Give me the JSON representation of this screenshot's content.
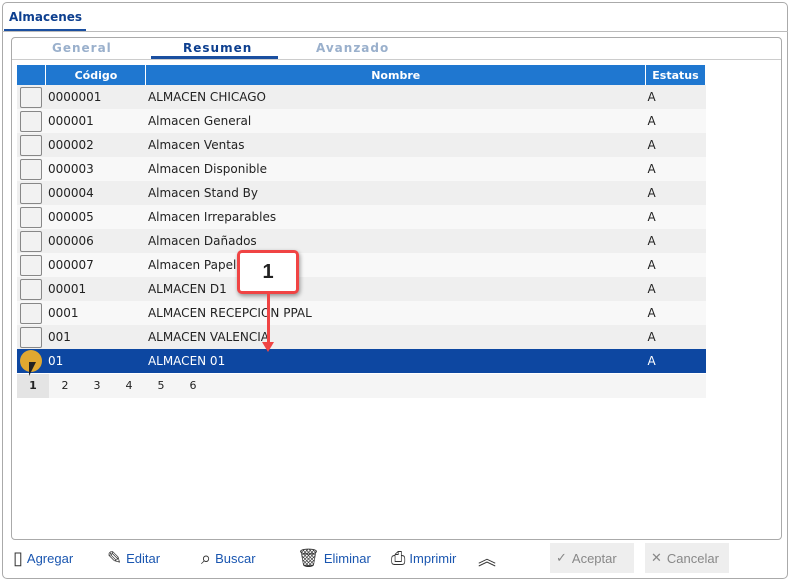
{
  "window": {
    "tab": "Almacenes"
  },
  "subtabs": [
    {
      "label": "General"
    },
    {
      "label": "Resumen"
    },
    {
      "label": "Avanzado"
    }
  ],
  "table": {
    "columns": [
      "",
      "Código",
      "Nombre",
      "Estatus"
    ],
    "rows": [
      {
        "code": "0000001",
        "name": "ALMACEN CHICAGO",
        "status": "A"
      },
      {
        "code": "000001",
        "name": "Almacen General",
        "status": "A"
      },
      {
        "code": "000002",
        "name": "Almacen Ventas",
        "status": "A"
      },
      {
        "code": "000003",
        "name": "Almacen Disponible",
        "status": "A"
      },
      {
        "code": "000004",
        "name": "Almacen Stand By",
        "status": "A"
      },
      {
        "code": "000005",
        "name": "Almacen Irreparables",
        "status": "A"
      },
      {
        "code": "000006",
        "name": "Almacen Dañados",
        "status": "A"
      },
      {
        "code": "000007",
        "name": "Almacen Papeleria",
        "status": "A"
      },
      {
        "code": "00001",
        "name": "ALMACEN D1",
        "status": "A"
      },
      {
        "code": "0001",
        "name": "ALMACEN RECEPCION PPAL",
        "status": "A"
      },
      {
        "code": "001",
        "name": "ALMACEN VALENCIA",
        "status": "A"
      },
      {
        "code": "01",
        "name": "ALMACEN 01",
        "status": "A",
        "selected": true
      }
    ]
  },
  "pagination": {
    "pages": [
      "1",
      "2",
      "3",
      "4",
      "5",
      "6"
    ],
    "current": "1"
  },
  "annotation": {
    "label": "1",
    "color": "#f04444"
  },
  "toolbar": {
    "add": "Agregar",
    "edit": "Editar",
    "search": "Buscar",
    "delete": "Eliminar",
    "print": "Imprimir",
    "accept": "Aceptar",
    "cancel": "Cancelar"
  },
  "colors": {
    "header": "#1f77d0",
    "selected_row": "#0d47a1",
    "accent": "#1a4fa0"
  }
}
